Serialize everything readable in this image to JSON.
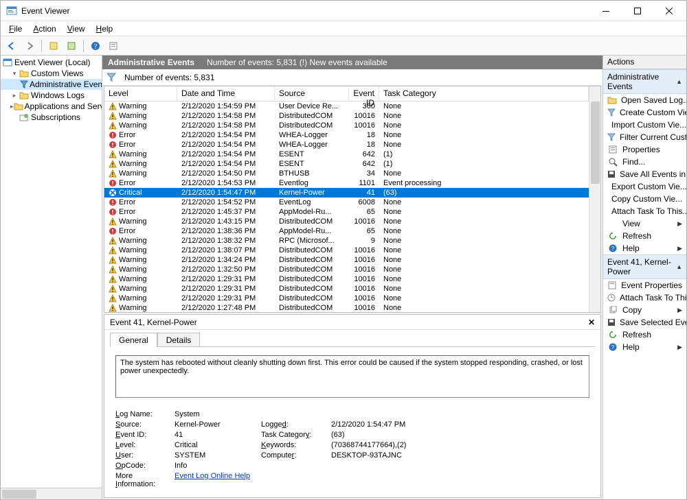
{
  "window": {
    "title": "Event Viewer"
  },
  "menu": {
    "file": "File",
    "action": "Action",
    "view": "View",
    "help": "Help"
  },
  "tree": {
    "root": "Event Viewer (Local)",
    "custom_views": "Custom Views",
    "admin_events": "Administrative Events",
    "windows_logs": "Windows Logs",
    "app_services": "Applications and Services Lo",
    "subscriptions": "Subscriptions"
  },
  "midheader": {
    "title": "Administrative Events",
    "summary": "Number of events: 5,831 (!) New events available"
  },
  "filterrow": {
    "count_label": "Number of events: 5,831"
  },
  "columns": {
    "level": "Level",
    "date": "Date and Time",
    "source": "Source",
    "eid": "Event ID",
    "cat": "Task Category"
  },
  "events": [
    {
      "level": "Warning",
      "date": "2/12/2020 1:54:59 PM",
      "source": "User Device Re...",
      "eid": "360",
      "cat": "None"
    },
    {
      "level": "Warning",
      "date": "2/12/2020 1:54:58 PM",
      "source": "DistributedCOM",
      "eid": "10016",
      "cat": "None"
    },
    {
      "level": "Warning",
      "date": "2/12/2020 1:54:58 PM",
      "source": "DistributedCOM",
      "eid": "10016",
      "cat": "None"
    },
    {
      "level": "Error",
      "date": "2/12/2020 1:54:54 PM",
      "source": "WHEA-Logger",
      "eid": "18",
      "cat": "None"
    },
    {
      "level": "Error",
      "date": "2/12/2020 1:54:54 PM",
      "source": "WHEA-Logger",
      "eid": "18",
      "cat": "None"
    },
    {
      "level": "Warning",
      "date": "2/12/2020 1:54:54 PM",
      "source": "ESENT",
      "eid": "642",
      "cat": "(1)"
    },
    {
      "level": "Warning",
      "date": "2/12/2020 1:54:54 PM",
      "source": "ESENT",
      "eid": "642",
      "cat": "(1)"
    },
    {
      "level": "Warning",
      "date": "2/12/2020 1:54:50 PM",
      "source": "BTHUSB",
      "eid": "34",
      "cat": "None"
    },
    {
      "level": "Error",
      "date": "2/12/2020 1:54:53 PM",
      "source": "Eventlog",
      "eid": "1101",
      "cat": "Event processing"
    },
    {
      "level": "Critical",
      "date": "2/12/2020 1:54:47 PM",
      "source": "Kernel-Power",
      "eid": "41",
      "cat": "(63)",
      "selected": true
    },
    {
      "level": "Error",
      "date": "2/12/2020 1:54:52 PM",
      "source": "EventLog",
      "eid": "6008",
      "cat": "None"
    },
    {
      "level": "Error",
      "date": "2/12/2020 1:45:37 PM",
      "source": "AppModel-Ru...",
      "eid": "65",
      "cat": "None"
    },
    {
      "level": "Warning",
      "date": "2/12/2020 1:43:15 PM",
      "source": "DistributedCOM",
      "eid": "10016",
      "cat": "None"
    },
    {
      "level": "Error",
      "date": "2/12/2020 1:38:36 PM",
      "source": "AppModel-Ru...",
      "eid": "65",
      "cat": "None"
    },
    {
      "level": "Warning",
      "date": "2/12/2020 1:38:32 PM",
      "source": "RPC (Microsof...",
      "eid": "9",
      "cat": "None"
    },
    {
      "level": "Warning",
      "date": "2/12/2020 1:38:07 PM",
      "source": "DistributedCOM",
      "eid": "10016",
      "cat": "None"
    },
    {
      "level": "Warning",
      "date": "2/12/2020 1:34:24 PM",
      "source": "DistributedCOM",
      "eid": "10016",
      "cat": "None"
    },
    {
      "level": "Warning",
      "date": "2/12/2020 1:32:50 PM",
      "source": "DistributedCOM",
      "eid": "10016",
      "cat": "None"
    },
    {
      "level": "Warning",
      "date": "2/12/2020 1:29:31 PM",
      "source": "DistributedCOM",
      "eid": "10016",
      "cat": "None"
    },
    {
      "level": "Warning",
      "date": "2/12/2020 1:29:31 PM",
      "source": "DistributedCOM",
      "eid": "10016",
      "cat": "None"
    },
    {
      "level": "Warning",
      "date": "2/12/2020 1:29:31 PM",
      "source": "DistributedCOM",
      "eid": "10016",
      "cat": "None"
    },
    {
      "level": "Warning",
      "date": "2/12/2020 1:27:48 PM",
      "source": "DistributedCOM",
      "eid": "10016",
      "cat": "None"
    }
  ],
  "detail": {
    "header": "Event 41, Kernel-Power",
    "tab_general": "General",
    "tab_details": "Details",
    "description": "The system has rebooted without cleanly shutting down first. This error could be caused if the system stopped responding, crashed, or lost power unexpectedly.",
    "log_name_k": "Log Name:",
    "log_name": "System",
    "source_k": "Source:",
    "source": "Kernel-Power",
    "logged_k": "Logged:",
    "logged": "2/12/2020 1:54:47 PM",
    "eventid_k": "Event ID:",
    "eventid": "41",
    "taskcat_k": "Task Category:",
    "taskcat": "(63)",
    "level_k": "Level:",
    "level": "Critical",
    "keywords_k": "Keywords:",
    "keywords": "(70368744177664),(2)",
    "user_k": "User:",
    "user": "SYSTEM",
    "computer_k": "Computer:",
    "computer": "DESKTOP-93TAJNC",
    "opcode_k": "OpCode:",
    "opcode": "Info",
    "moreinfo_k": "More Information:",
    "moreinfo_link": "Event Log Online Help"
  },
  "actions": {
    "header": "Actions",
    "group1_title": "Administrative Events",
    "open_saved": "Open Saved Log...",
    "create_custom": "Create Custom Vie...",
    "import_custom": "Import Custom Vie...",
    "filter_current": "Filter Current Cust...",
    "properties": "Properties",
    "find": "Find...",
    "save_all": "Save All Events in ...",
    "export_custom": "Export Custom Vie...",
    "copy_custom": "Copy Custom Vie...",
    "attach_task": "Attach Task To This...",
    "view": "View",
    "refresh": "Refresh",
    "help": "Help",
    "group2_title": "Event 41, Kernel-Power",
    "event_props": "Event Properties",
    "attach_task2": "Attach Task To This...",
    "copy": "Copy",
    "save_selected": "Save Selected Even...",
    "refresh2": "Refresh",
    "help2": "Help"
  }
}
